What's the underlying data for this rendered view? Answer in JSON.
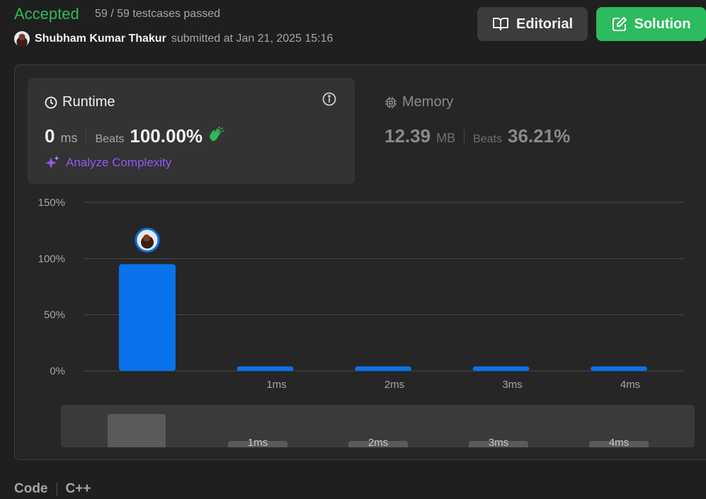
{
  "header": {
    "status": "Accepted",
    "testcases": "59 / 59 testcases passed",
    "author": "Shubham Kumar Thakur",
    "submitted": "submitted at Jan 21, 2025 15:16",
    "editorial_label": "Editorial",
    "solution_label": "Solution"
  },
  "runtime": {
    "title": "Runtime",
    "value": "0",
    "unit": "ms",
    "beats_label": "Beats",
    "beats": "100.00%",
    "analyze_label": "Analyze Complexity"
  },
  "memory": {
    "title": "Memory",
    "value": "12.39",
    "unit": "MB",
    "beats_label": "Beats",
    "beats": "36.21%"
  },
  "footer": {
    "code_label": "Code",
    "language": "C++"
  },
  "colors": {
    "accepted": "#2cbb5d",
    "bar": "#0a72ea",
    "analyze": "#8b5cf6"
  },
  "chart_data": {
    "type": "bar",
    "categories": [
      "",
      "1ms",
      "2ms",
      "3ms",
      "4ms"
    ],
    "values": [
      95,
      4,
      4,
      4,
      4
    ],
    "ylim": [
      0,
      150
    ],
    "yticks": [
      "0%",
      "50%",
      "100%",
      "150%"
    ],
    "grid": true,
    "mini_labels": [
      "1ms",
      "2ms",
      "3ms",
      "4ms"
    ]
  }
}
